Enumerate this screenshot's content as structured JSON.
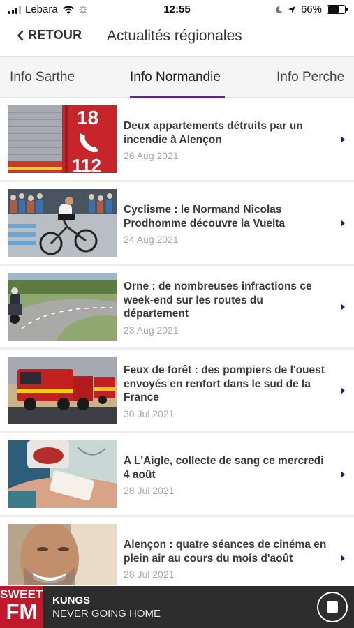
{
  "status": {
    "carrier": "Lebara",
    "time": "12:55",
    "battery": "66%",
    "battery_level": 0.66
  },
  "nav": {
    "back_label": "RETOUR",
    "title": "Actualités régionales"
  },
  "tabs": [
    {
      "label": "Info Sarthe"
    },
    {
      "label": "Info Normandie"
    },
    {
      "label": "Info Perche"
    }
  ],
  "articles": [
    {
      "title": "Deux appartements détruits par un incendie à Alençon",
      "date": "26 Aug 2021",
      "image": "fire-truck-18-112"
    },
    {
      "title": "Cyclisme : le Normand Nicolas Prodhomme découvre la Vuelta",
      "date": "24 Aug 2021",
      "image": "cyclist-race"
    },
    {
      "title": "Orne : de nombreuses infractions ce week-end sur les routes du département",
      "date": "23 Aug 2021",
      "image": "motorbike-road"
    },
    {
      "title": "Feux de forêt : des pompiers de l'ouest envoyés en renfort dans le sud de la France",
      "date": "30 Jul 2021",
      "image": "fire-engines"
    },
    {
      "title": "A L'Aigle, collecte de sang ce mercredi 4 août",
      "date": "28 Jul 2021",
      "image": "blood-donation"
    },
    {
      "title": "Alençon : quatre séances de cinéma en plein air au cours du mois d'août",
      "date": "28 Jul 2021",
      "image": "actor-portrait"
    }
  ],
  "player": {
    "logo_top": "SWEET",
    "logo_bottom": "FM",
    "artist": "KUNGS",
    "track": "NEVER GOING HOME"
  },
  "colors": {
    "accent": "#5a2d6f",
    "brand_red": "#c0192b",
    "player_bg": "#2d2d2d"
  }
}
